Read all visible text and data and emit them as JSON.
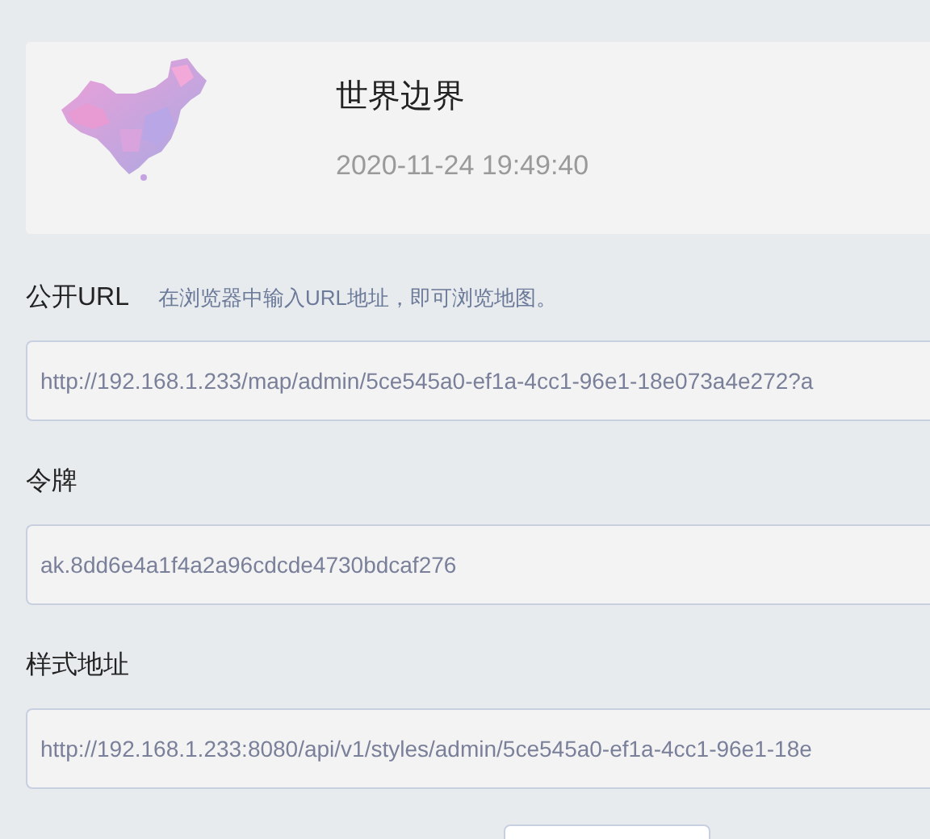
{
  "map": {
    "title": "世界边界",
    "timestamp": "2020-11-24 19:49:40"
  },
  "fields": [
    {
      "label": "公开URL",
      "hint": "在浏览器中输入URL地址，即可浏览地图。",
      "value": "http://192.168.1.233/map/admin/5ce545a0-ef1a-4cc1-96e1-18e073a4e272?a"
    },
    {
      "label": "令牌",
      "value": "ak.8dd6e4a1f4a2a96cdcde4730bdcaf276"
    },
    {
      "label": "样式地址",
      "value": "http://192.168.1.233:8080/api/v1/styles/admin/5ce545a0-ef1a-4cc1-96e1-18e"
    }
  ]
}
